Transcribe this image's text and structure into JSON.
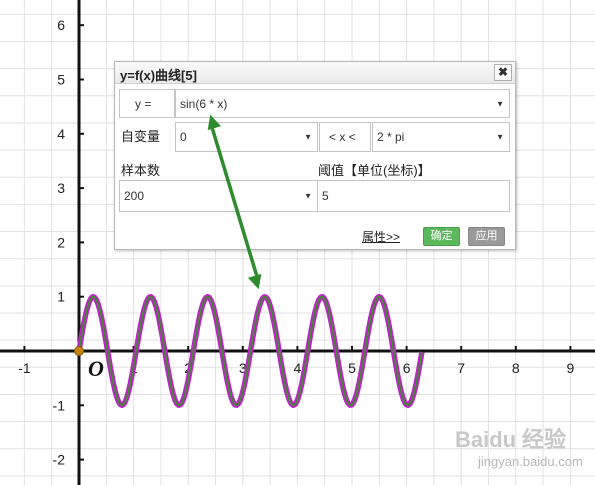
{
  "chart_data": {
    "type": "line",
    "x_ticks": [
      "-1",
      "1",
      "2",
      "3",
      "4",
      "5",
      "6",
      "7",
      "8",
      "9"
    ],
    "y_ticks": [
      "6",
      "5",
      "4",
      "3",
      "2",
      "1",
      "-1",
      "-2"
    ],
    "origin_label": "O",
    "xlim": [
      -1.5,
      9.6
    ],
    "ylim": [
      -2.3,
      6.5
    ],
    "grid": true,
    "series": [
      {
        "expression": "sin(6 * x)",
        "x_range": [
          0,
          6.28
        ],
        "samples": 200,
        "color": "#c21fcf",
        "inner_color": "#3f8a2c"
      }
    ],
    "start_point": {
      "x": 0,
      "y": 0,
      "color": "#c58412"
    }
  },
  "dialog": {
    "title": "y=f(x)曲线[5]",
    "close_glyph": "✖",
    "y_label": "y =",
    "expression": "sin(6 * x)",
    "var_label": "自变量",
    "x_min": "0",
    "x_between": "< x <",
    "x_max": "2 * pi",
    "samples_label": "样本数",
    "samples_value": "200",
    "threshold_label": "阈值【单位(坐标)】",
    "threshold_value": "5",
    "attr_link": "属性>>",
    "ok_button": "确定",
    "apply_button": "应用",
    "dropdown_glyph": "▼"
  },
  "annotation": {
    "arrow_color": "#2e8b2e"
  },
  "watermark": {
    "logo": "Baidu",
    "site": "jingyan.baidu.com",
    "name": "经验"
  }
}
